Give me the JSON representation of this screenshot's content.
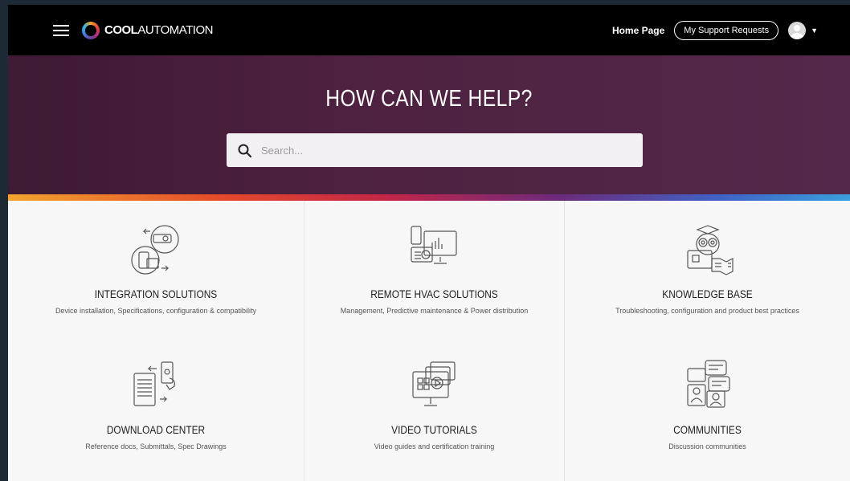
{
  "header": {
    "logo_bold": "COOL",
    "logo_light": "AUTOMATION",
    "home_link": "Home Page",
    "support_button": "My Support Requests"
  },
  "hero": {
    "title": "HOW CAN WE HELP?",
    "search_placeholder": "Search..."
  },
  "colors": {
    "topbar": "#000000",
    "hero": "#4d213f",
    "stripe": [
      "#f2a52e",
      "#e54a2a",
      "#c42548",
      "#6d2a7a",
      "#3f63c7",
      "#3a9fdc"
    ]
  },
  "cards": [
    {
      "icon": "integration-icon",
      "title": "INTEGRATION SOLUTIONS",
      "subtitle": "Device installation, Specifications, configuration & compatibility"
    },
    {
      "icon": "remote-hvac-icon",
      "title": "REMOTE HVAC SOLUTIONS",
      "subtitle": "Management, Predictive maintenance & Power distribution"
    },
    {
      "icon": "knowledge-owl-icon",
      "title": "KNOWLEDGE BASE",
      "subtitle": "Troubleshooting, configuration and product best practices"
    },
    {
      "icon": "download-icon",
      "title": "DOWNLOAD CENTER",
      "subtitle": "Reference docs, Submittals, Spec Drawings"
    },
    {
      "icon": "video-icon",
      "title": "VIDEO TUTORIALS",
      "subtitle": "Video guides and certification training"
    },
    {
      "icon": "communities-icon",
      "title": "COMMUNITIES",
      "subtitle": "Discussion communities"
    }
  ]
}
